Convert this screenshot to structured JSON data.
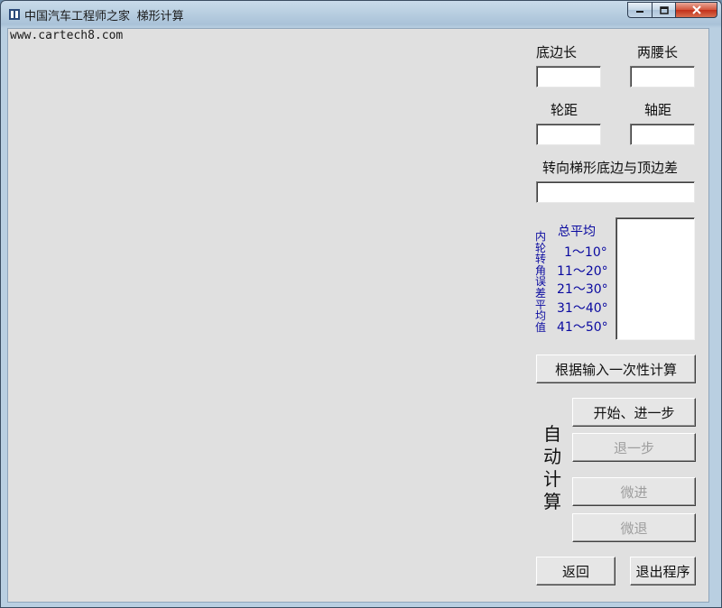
{
  "window": {
    "title": "中国汽车工程师之家",
    "subtitle_overlay": "梯形计算",
    "url_text": "www.cartech8.com"
  },
  "inputs": {
    "base_length": {
      "label": "底边长",
      "value": ""
    },
    "leg_length": {
      "label": "两腰长",
      "value": ""
    },
    "track": {
      "label": "轮距",
      "value": ""
    },
    "wheelbase": {
      "label": "轴距",
      "value": ""
    },
    "base_top_diff": {
      "label": "转向梯形底边与顶边差",
      "value": ""
    }
  },
  "error_panel": {
    "vertical_label": [
      "内",
      "轮",
      "转",
      "角",
      "误",
      "差",
      "平",
      "均",
      "值"
    ],
    "rows": [
      "总平均",
      "1～10°",
      "11～20°",
      "21～30°",
      "31～40°",
      "41～50°"
    ]
  },
  "buttons": {
    "compute_once": "根据输入一次性计算",
    "start_step": "开始、进一步",
    "step_back": "退一步",
    "fine_forward": "微进",
    "fine_back": "微退",
    "return": "返回",
    "exit": "退出程序"
  },
  "auto_label": [
    "自",
    "动",
    "计",
    "算"
  ]
}
